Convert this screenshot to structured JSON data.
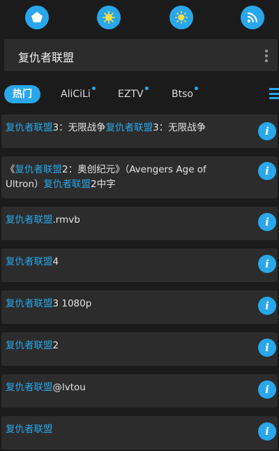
{
  "top_icons": [
    "pentagon-home-icon",
    "sparkle-icon",
    "sun-icon",
    "rss-icon"
  ],
  "search": {
    "title": "复仇者联盟"
  },
  "tabs": [
    {
      "label": "热门",
      "active": true,
      "dot": false
    },
    {
      "label": "AliCiLi",
      "active": false,
      "dot": true
    },
    {
      "label": "EZTV",
      "active": false,
      "dot": true
    },
    {
      "label": "Btso",
      "active": false,
      "dot": true
    }
  ],
  "results": [
    {
      "parts": [
        {
          "t": "复仇者联盟",
          "hl": true
        },
        {
          "t": "3：无限战争",
          "hl": false
        },
        {
          "t": "复仇者联盟",
          "hl": true
        },
        {
          "t": "3：无限战争",
          "hl": false
        }
      ]
    },
    {
      "parts": [
        {
          "t": "《",
          "hl": false
        },
        {
          "t": "复仇者联盟",
          "hl": true
        },
        {
          "t": "2：奥创纪元》（Avengers Age of Ultron）",
          "hl": false
        },
        {
          "t": "复仇者联盟",
          "hl": true
        },
        {
          "t": "2中字",
          "hl": false
        }
      ]
    },
    {
      "parts": [
        {
          "t": "复仇者联盟",
          "hl": true
        },
        {
          "t": ".rmvb",
          "hl": false
        }
      ]
    },
    {
      "parts": [
        {
          "t": "复仇者联盟",
          "hl": true
        },
        {
          "t": "4",
          "hl": false
        }
      ]
    },
    {
      "parts": [
        {
          "t": "复仇者联盟",
          "hl": true
        },
        {
          "t": "3 1080p",
          "hl": false
        }
      ]
    },
    {
      "parts": [
        {
          "t": "复仇者联盟",
          "hl": true
        },
        {
          "t": "2",
          "hl": false
        }
      ]
    },
    {
      "parts": [
        {
          "t": "复仇者联盟",
          "hl": true
        },
        {
          "t": "@lvtou",
          "hl": false
        }
      ]
    },
    {
      "parts": [
        {
          "t": "复仇者联盟",
          "hl": true
        }
      ]
    }
  ],
  "info_label": "i",
  "accent_color": "#29a7ea"
}
